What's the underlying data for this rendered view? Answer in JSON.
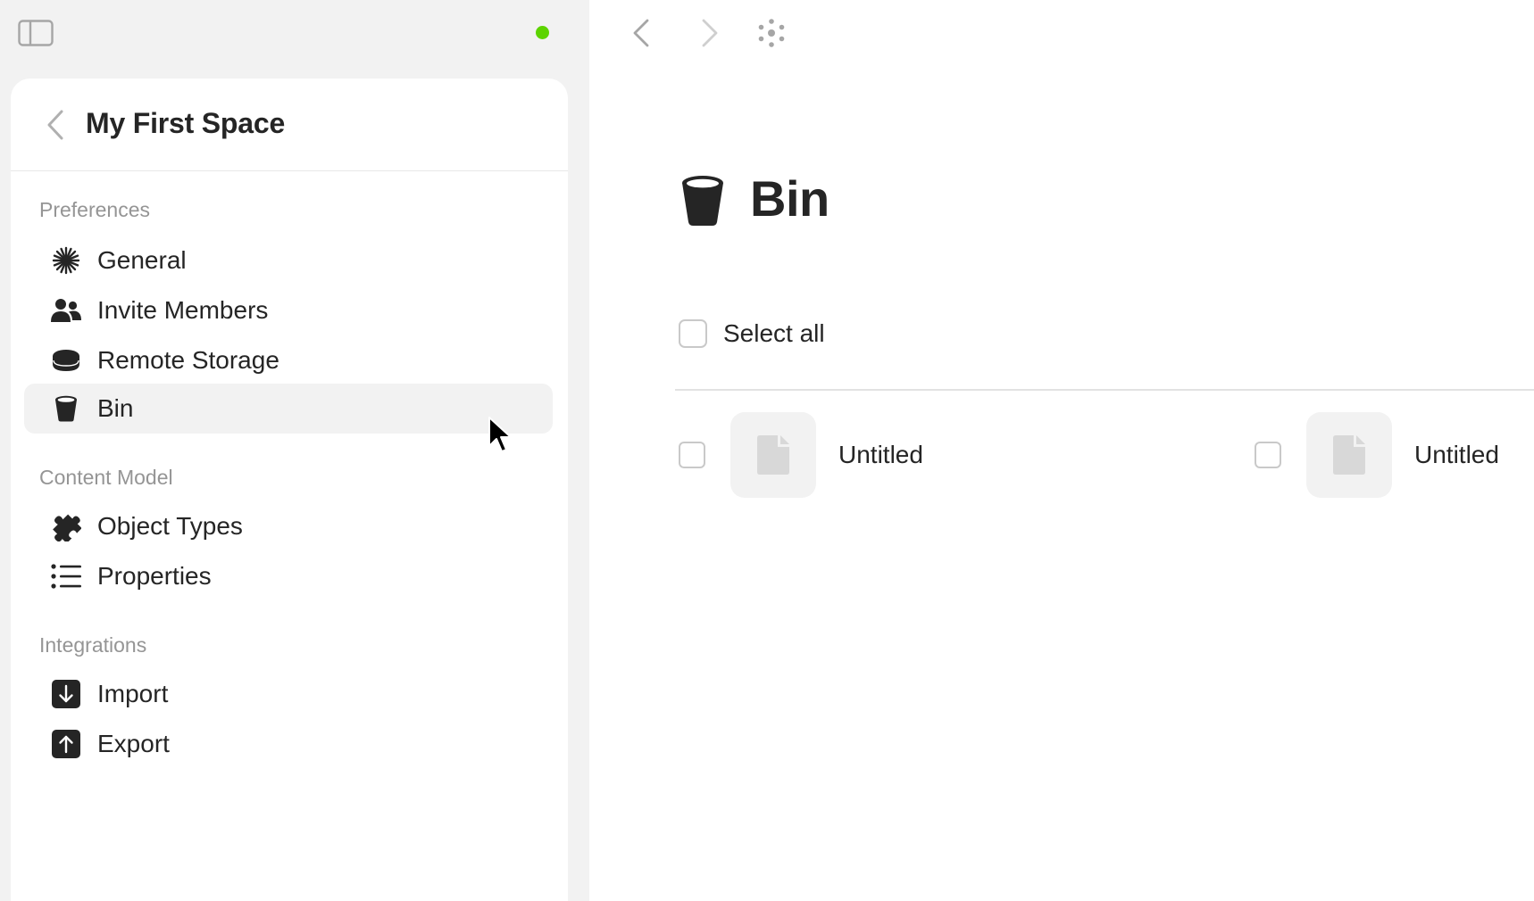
{
  "sidebar": {
    "space_title": "My First Space",
    "sections": [
      {
        "label": "Preferences",
        "items": [
          {
            "label": "General",
            "icon": "asterisk-icon",
            "active": false
          },
          {
            "label": "Invite Members",
            "icon": "people-icon",
            "active": false
          },
          {
            "label": "Remote Storage",
            "icon": "disk-icon",
            "active": false
          },
          {
            "label": "Bin",
            "icon": "bin-icon",
            "active": true
          }
        ]
      },
      {
        "label": "Content Model",
        "items": [
          {
            "label": "Object Types",
            "icon": "puzzle-icon",
            "active": false
          },
          {
            "label": "Properties",
            "icon": "list-icon",
            "active": false
          }
        ]
      },
      {
        "label": "Integrations",
        "items": [
          {
            "label": "Import",
            "icon": "import-icon",
            "active": false
          },
          {
            "label": "Export",
            "icon": "export-icon",
            "active": false
          }
        ]
      }
    ]
  },
  "main": {
    "title": "Bin",
    "title_icon": "bin-icon",
    "select_all_label": "Select all",
    "items": [
      {
        "name": "Untitled",
        "icon": "document-icon"
      },
      {
        "name": "Untitled",
        "icon": "document-icon"
      }
    ]
  },
  "colors": {
    "sync_status": "#5dd400",
    "sidebar_background": "#f2f2f2",
    "active_item_background": "#f2f2f2",
    "section_label": "#959595",
    "text": "#252525"
  }
}
